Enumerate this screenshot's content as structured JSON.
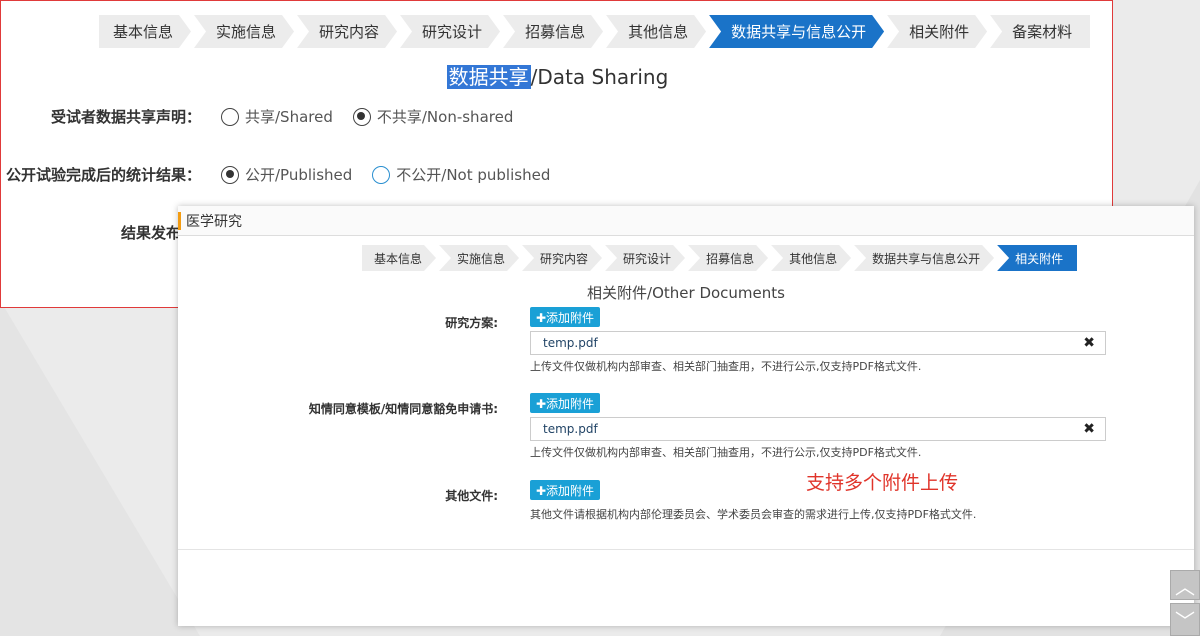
{
  "back_panel": {
    "steps": [
      "基本信息",
      "实施信息",
      "研究内容",
      "研究设计",
      "招募信息",
      "其他信息",
      "数据共享与信息公开",
      "相关附件",
      "备案材料"
    ],
    "active_step_index": 6,
    "title_highlight": "数据共享",
    "title_rest": "/Data Sharing",
    "rows": [
      {
        "label": "受试者数据共享声明：",
        "options": [
          {
            "text": "共享/Shared",
            "checked": false
          },
          {
            "text": "不共享/Non-shared",
            "checked": true
          }
        ]
      },
      {
        "label": "公开试验完成后的统计结果：",
        "options": [
          {
            "text": "公开/Published",
            "checked": true
          },
          {
            "text": "不公开/Not published",
            "checked": false
          }
        ]
      }
    ],
    "partial_label": "结果发布"
  },
  "front_panel": {
    "header": "医学研究",
    "steps": [
      "基本信息",
      "实施信息",
      "研究内容",
      "研究设计",
      "招募信息",
      "其他信息",
      "数据共享与信息公开",
      "相关附件"
    ],
    "active_step_index": 7,
    "title": "相关附件/Other Documents",
    "add_label": "✚添加附件",
    "sections": [
      {
        "label": "研究方案:",
        "file": "temp.pdf",
        "note": "上传文件仅做机构内部审查、相关部门抽查用，不进行公示,仅支持PDF格式文件."
      },
      {
        "label": "知情同意模板/知情同意豁免申请书:",
        "file": "temp.pdf",
        "note": "上传文件仅做机构内部审查、相关部门抽查用，不进行公示,仅支持PDF格式文件."
      },
      {
        "label": "其他文件:",
        "note": "其他文件请根据机构内部伦理委员会、学术委员会审查的需求进行上传,仅支持PDF格式文件."
      }
    ],
    "red_tip": "支持多个附件上传"
  },
  "icons": {
    "remove": "close-icon",
    "scroll_up": "chevron-up-icon",
    "scroll_down": "chevron-down-icon"
  },
  "colors": {
    "active_step": "#1a73c8",
    "add_button": "#1aa0d6",
    "tip": "#e0342a",
    "frame": "#e03a3a"
  }
}
